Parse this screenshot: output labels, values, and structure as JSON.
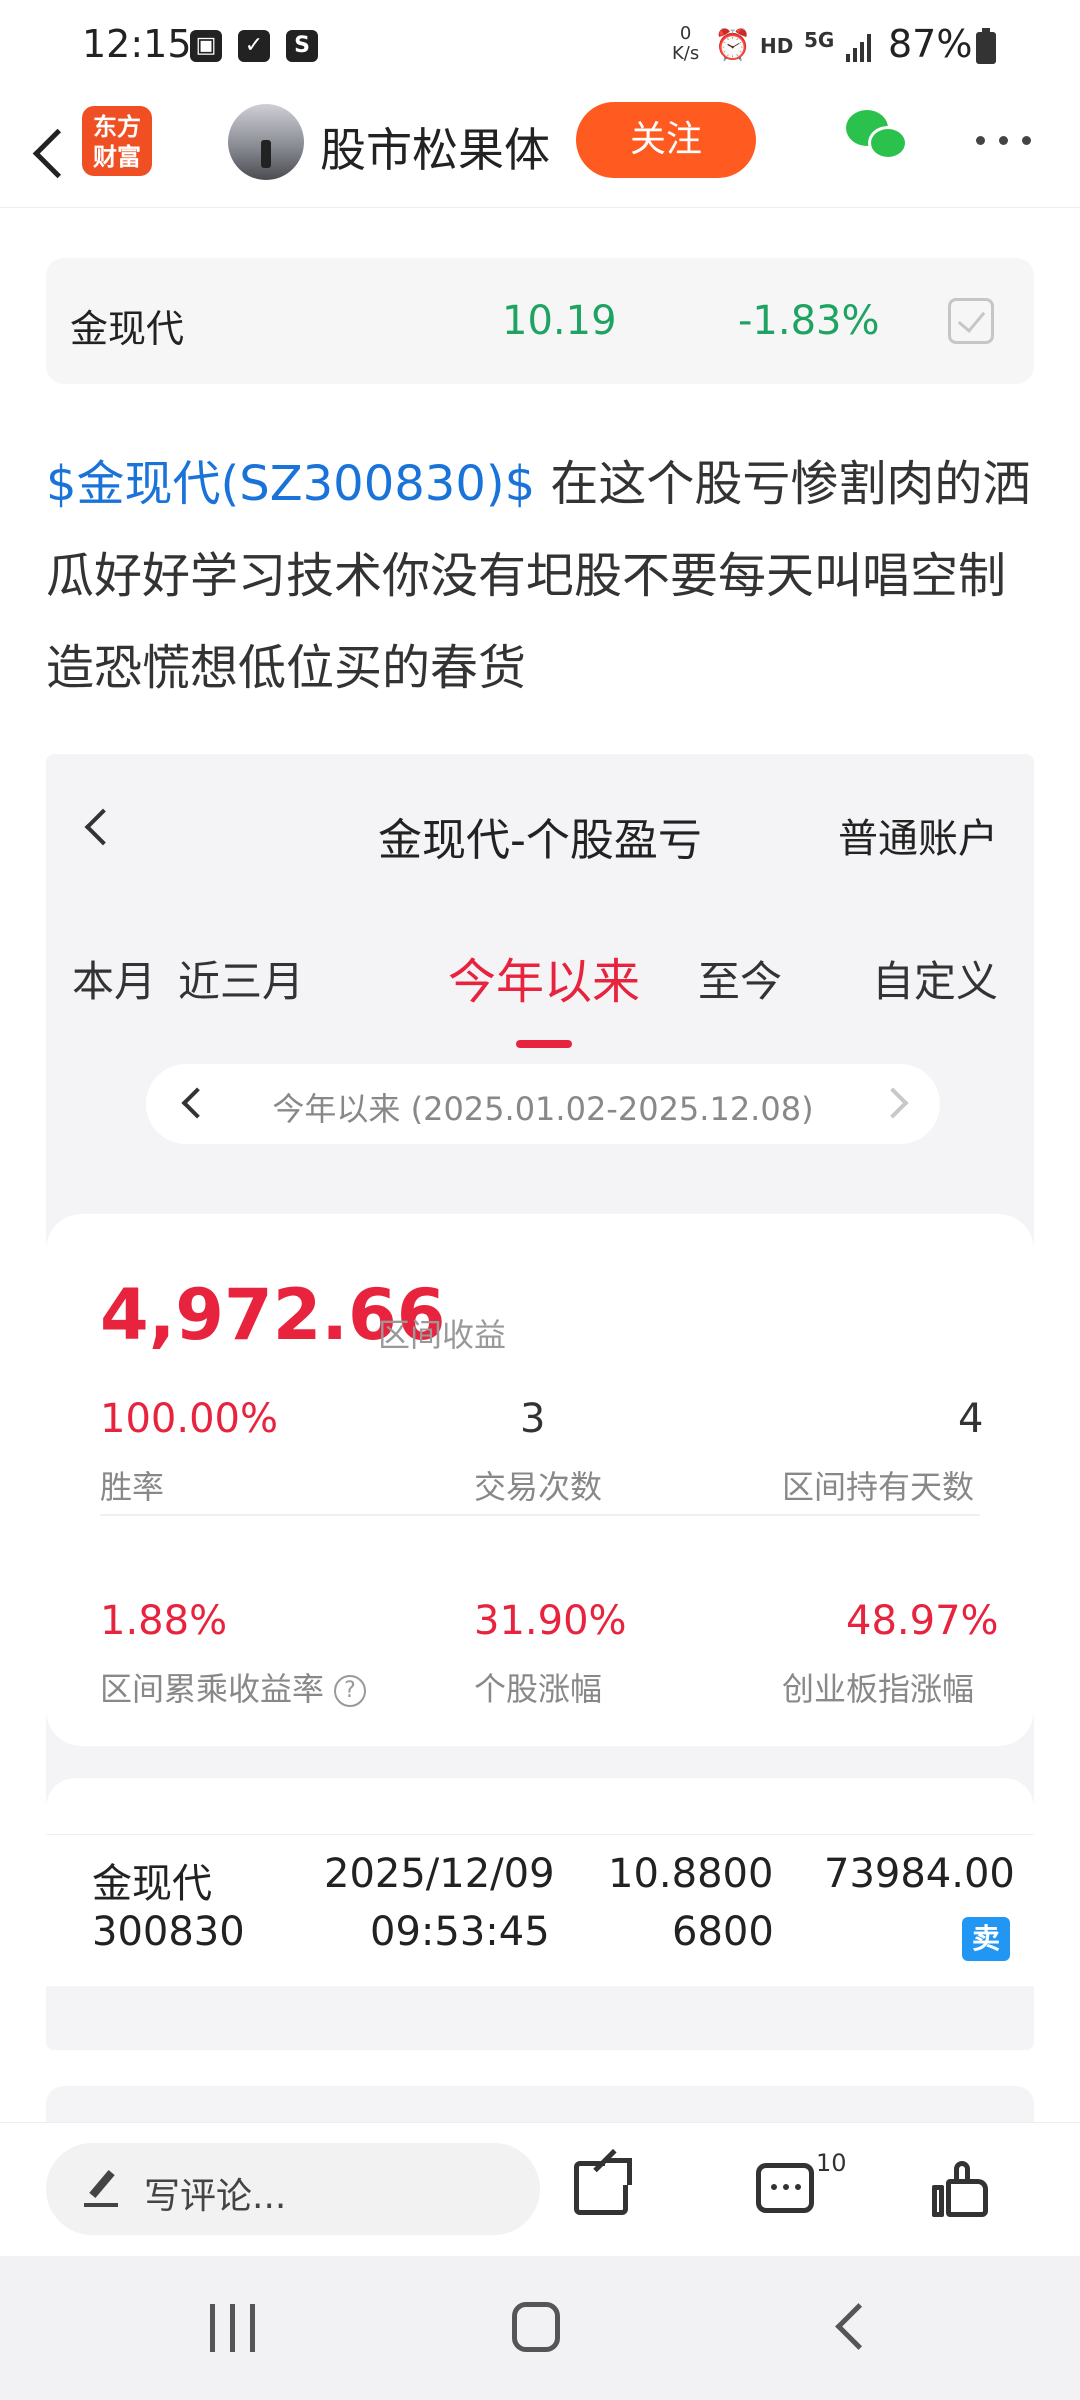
{
  "status_bar": {
    "time": "12:15",
    "net_speed_value": "0",
    "net_speed_unit": "K/s",
    "hd_label": "HD",
    "network_label": "5G",
    "battery": "87%",
    "app_badge": "S"
  },
  "header": {
    "app_logo_line1": "东方",
    "app_logo_line2": "财富",
    "author_name": "股市松果体",
    "follow_label": "关注"
  },
  "quote": {
    "name": "金现代",
    "price": "10.19",
    "change": "-1.83%",
    "color_down": "#1ea362"
  },
  "post": {
    "stock_link": "$金现代(SZ300830)$",
    "text": " 在这个股亏惨割肉的洒瓜好好学习技术你没有圯股不要每天叫唱空制造恐慌想低位买的春货"
  },
  "embedded": {
    "title": "金现代-个股盈亏",
    "account": "普通账户",
    "tabs": [
      {
        "label": "本月"
      },
      {
        "label": "近三月"
      },
      {
        "label": "今年以来"
      },
      {
        "label": "至今"
      },
      {
        "label": "自定义"
      }
    ],
    "active_tab": "今年以来",
    "range_text": "今年以来 (2025.01.02-2025.12.08)",
    "profit_value": "4,972.66",
    "profit_label": "区间收益",
    "stats_row1": [
      {
        "value": "100.00%",
        "label": "胜率"
      },
      {
        "value": "3",
        "label": "交易次数"
      },
      {
        "value": "4",
        "label": "区间持有天数"
      }
    ],
    "stats_row2": [
      {
        "value": "1.88%",
        "label": "区间累乘收益率"
      },
      {
        "value": "31.90%",
        "label": "个股涨幅"
      },
      {
        "value": "48.97%",
        "label": "创业板指涨幅"
      }
    ],
    "help_glyph": "?",
    "trade": {
      "name": "金现代",
      "code": "300830",
      "date": "2025/12/09",
      "time": "09:53:45",
      "price": "10.8800",
      "quantity": "6800",
      "amount": "73984.00",
      "side": "卖"
    },
    "accent_color": "#e8233e"
  },
  "comment_bar": {
    "placeholder": "写评论...",
    "comment_count": "10"
  }
}
